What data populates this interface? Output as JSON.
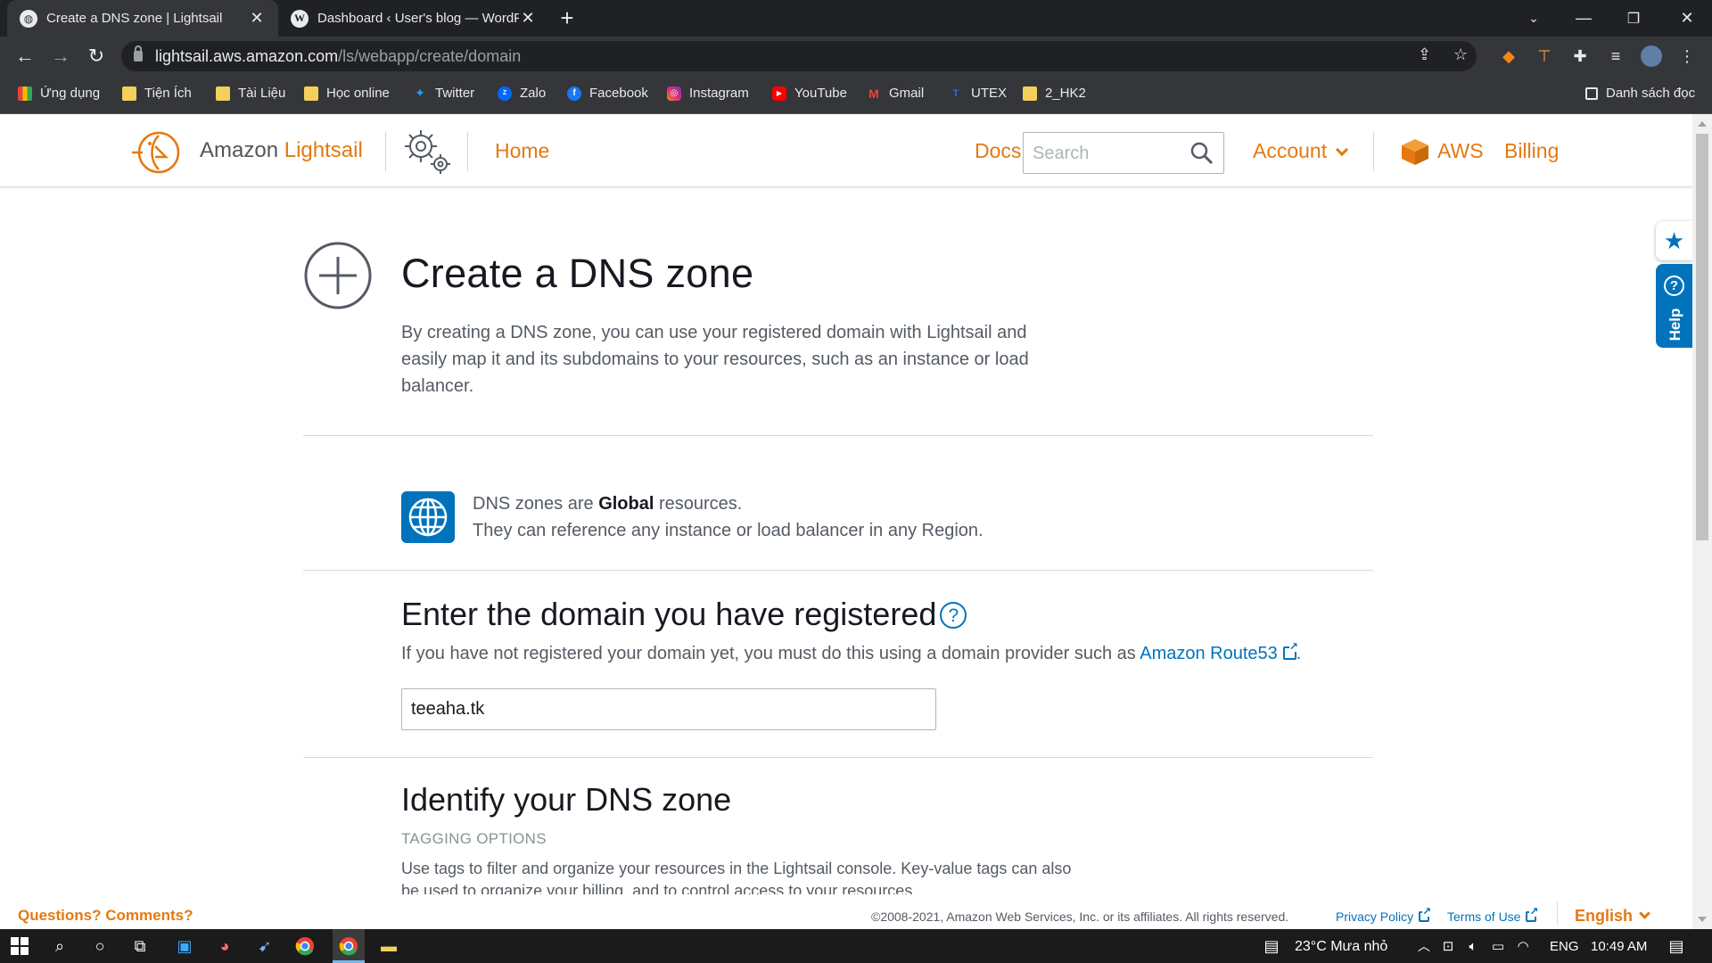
{
  "browser": {
    "tabs": [
      {
        "title": "Create a DNS zone | Lightsail",
        "active": true
      },
      {
        "title": "Dashboard ‹ User's blog — WordPress",
        "active": false
      }
    ],
    "url_host": "lightsail.aws.amazon.com",
    "url_path": "/ls/webapp/create/domain",
    "bookmarks": [
      {
        "label": "Ứng dụng",
        "icon": "apps-grid-icon"
      },
      {
        "label": "Tiện Ích",
        "icon": "folder-icon"
      },
      {
        "label": "Tài Liệu",
        "icon": "folder-icon"
      },
      {
        "label": "Học online",
        "icon": "folder-icon"
      },
      {
        "label": "Twitter",
        "icon": "twitter-icon"
      },
      {
        "label": "Zalo",
        "icon": "zalo-icon"
      },
      {
        "label": "Facebook",
        "icon": "facebook-icon"
      },
      {
        "label": "Instagram",
        "icon": "instagram-icon"
      },
      {
        "label": "YouTube",
        "icon": "youtube-icon"
      },
      {
        "label": "Gmail",
        "icon": "gmail-icon"
      },
      {
        "label": "UTEX",
        "icon": "utex-icon"
      },
      {
        "label": "2_HK2",
        "icon": "folder-icon"
      }
    ],
    "reading_list": "Danh sách đọc"
  },
  "header": {
    "brand_prefix": "Amazon",
    "brand_name": "Lightsail",
    "home": "Home",
    "docs": "Docs",
    "search_placeholder": "Search",
    "account": "Account",
    "aws": "AWS",
    "billing": "Billing"
  },
  "page": {
    "title": "Create a DNS zone",
    "intro": "By creating a DNS zone, you can use your registered domain with Lightsail and easily map it and its subdomains to your resources, such as an instance or load balancer.",
    "global_prefix": "DNS zones are",
    "global_bold": "Global",
    "global_suffix": "resources.",
    "global_line2": "They can reference any instance or load balancer in any Region.",
    "domain_heading": "Enter the domain you have registered",
    "domain_help_prefix": "If you have not registered your domain yet, you must do this using a domain provider such as",
    "domain_help_link": "Amazon Route53",
    "domain_value": "teeaha.tk",
    "identify_heading": "Identify your DNS zone",
    "tagging_label": "TAGGING OPTIONS",
    "tagging_desc": "Use tags to filter and organize your resources in the Lightsail console. Key-value tags can also be used to organize your billing, and to control access to your resources."
  },
  "footer": {
    "questions": "Questions? Comments?",
    "copyright": "©2008-2021, Amazon Web Services, Inc. or its affiliates. All rights reserved.",
    "privacy": "Privacy Policy",
    "terms": "Terms of Use",
    "language": "English"
  },
  "side": {
    "help": "Help"
  },
  "taskbar": {
    "weather": "23°C  Mưa nhỏ",
    "lang": "ENG",
    "time": "10:49 AM"
  },
  "colors": {
    "accent_orange": "#e47911",
    "link_blue": "#0073bb",
    "chrome_dark": "#202124"
  }
}
